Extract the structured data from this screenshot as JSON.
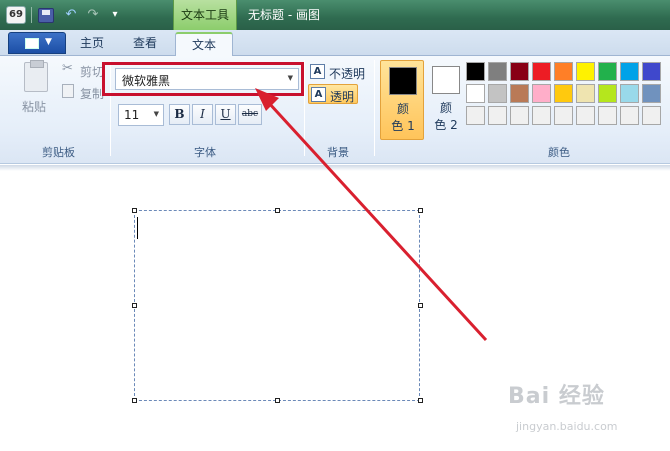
{
  "title_bar": {
    "app_icon_text": "69",
    "context_tab_label": "文本工具",
    "window_title": "无标题 - 画图",
    "icons": [
      "save-icon",
      "undo-icon",
      "redo-icon",
      "customize-quick-access-icon"
    ]
  },
  "tabs": {
    "home": "主页",
    "view": "查看",
    "text": "文本",
    "active": "text"
  },
  "clipboard": {
    "paste": "粘贴",
    "cut": "剪切",
    "copy": "复制",
    "group_label": "剪贴板"
  },
  "font": {
    "family_value": "微软雅黑",
    "size_value": "11",
    "bold": "B",
    "italic": "I",
    "underline": "U",
    "strikethrough": "abc",
    "group_label": "字体"
  },
  "background": {
    "opaque": "不透明",
    "transparent": "透明",
    "selected": "transparent",
    "group_label": "背景"
  },
  "colors": {
    "color1_label": "颜\n色 1",
    "color1_line1": "颜",
    "color1_line2": "色 1",
    "color2_line1": "颜",
    "color2_line2": "色 2",
    "color1_value": "#000000",
    "color2_value": "#ffffff",
    "group_label": "颜色",
    "palette": [
      "#000000",
      "#7f7f7f",
      "#880015",
      "#ed1c24",
      "#ff7f27",
      "#fff200",
      "#22b14c",
      "#00a2e8",
      "#3f48cc",
      "#ffffff",
      "#c3c3c3",
      "#b97a57",
      "#ffaec9",
      "#ffc90e",
      "#efe4b0",
      "#b5e61d",
      "#99d9ea",
      "#7092be",
      "#f0f0f0",
      "#f0f0f0",
      "#f0f0f0",
      "#f0f0f0",
      "#f0f0f0",
      "#f0f0f0",
      "#f0f0f0",
      "#f0f0f0",
      "#f0f0f0"
    ]
  },
  "annotation": {
    "highlight_color": "#c8102e",
    "arrow_color": "#d9202f"
  },
  "watermark": {
    "logo": "Bai 经验",
    "url": "jingyan.baidu.com"
  }
}
